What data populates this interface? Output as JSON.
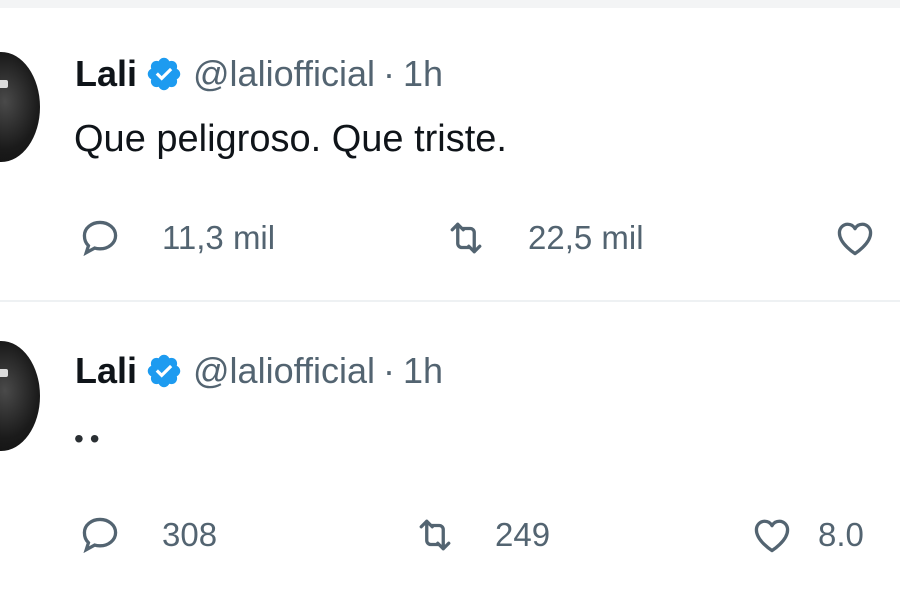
{
  "tweets": [
    {
      "display_name": "Lali",
      "handle": "@laliofficial",
      "separator": "·",
      "time": "1h",
      "text": "Que peligroso. Que triste.",
      "reply_count": "11,3 mil",
      "retweet_count": "22,5 mil",
      "like_count": ""
    },
    {
      "display_name": "Lali",
      "handle": "@laliofficial",
      "separator": "·",
      "time": "1h",
      "text": "••",
      "reply_count": "308",
      "retweet_count": "249",
      "like_count": "8.0"
    }
  ],
  "icons": {
    "verified": "verified-badge-icon",
    "reply": "reply-bubble-icon",
    "retweet": "retweet-arrows-icon",
    "like": "heart-icon"
  },
  "colors": {
    "verified": "#1d9bf0",
    "text": "#0f1419",
    "muted": "#536471"
  }
}
